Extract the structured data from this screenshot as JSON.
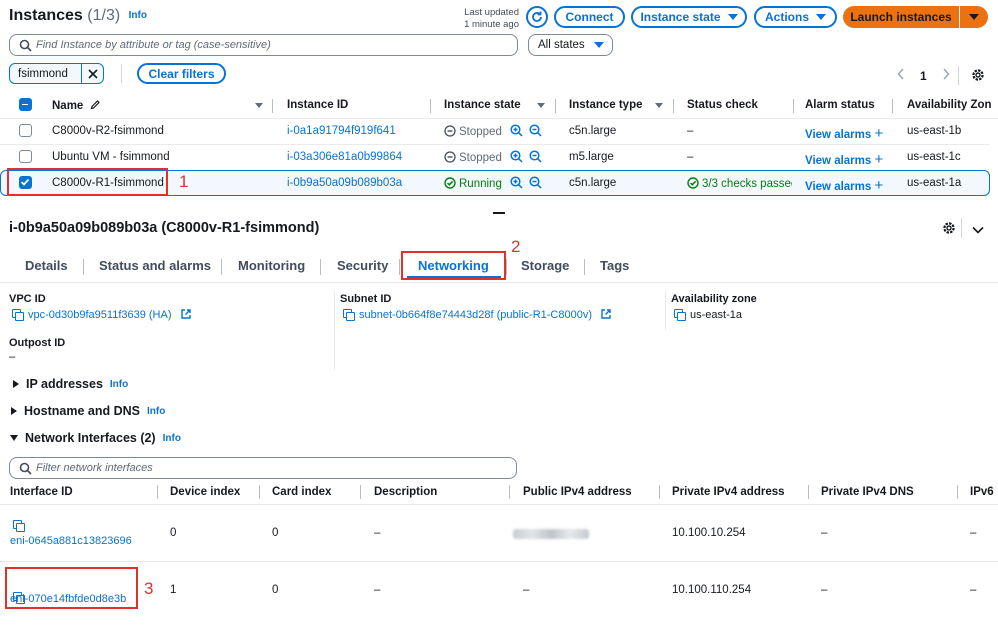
{
  "header": {
    "title": "Instances",
    "count": "(1/3)",
    "info": "Info",
    "last_updated_label": "Last updated",
    "last_updated_value": "1 minute ago",
    "connect": "Connect",
    "instance_state": "Instance state",
    "actions": "Actions",
    "launch": "Launch instances"
  },
  "search": {
    "placeholder": "Find Instance by attribute or tag (case-sensitive)",
    "states_select": "All states"
  },
  "filter": {
    "token": "fsimmond",
    "clear": "Clear filters",
    "page": "1"
  },
  "table": {
    "headers": [
      "Name",
      "Instance ID",
      "Instance state",
      "Instance type",
      "Status check",
      "Alarm status",
      "Availability Zon"
    ],
    "rows": [
      {
        "name": "C8000v-R2-fsimmond",
        "id": "i-0a1a91794f919f641",
        "state": "Stopped",
        "type": "c5n.large",
        "status": "–",
        "alarms": "View alarms",
        "az": "us-east-1b"
      },
      {
        "name": "Ubuntu VM - fsimmond",
        "id": "i-03a306e81a0b99864",
        "state": "Stopped",
        "type": "m5.large",
        "status": "–",
        "alarms": "View alarms",
        "az": "us-east-1c"
      },
      {
        "name": "C8000v-R1-fsimmond",
        "id": "i-0b9a50a09b089b03a",
        "state": "Running",
        "type": "c5n.large",
        "status": "3/3 checks passec",
        "alarms": "View alarms",
        "az": "us-east-1a"
      }
    ]
  },
  "detail": {
    "title": "i-0b9a50a09b089b03a (C8000v-R1-fsimmond)",
    "tabs": [
      "Details",
      "Status and alarms",
      "Monitoring",
      "Security",
      "Networking",
      "Storage",
      "Tags"
    ],
    "active_tab": "Networking",
    "vpc_label": "VPC ID",
    "vpc_value": "vpc-0d30b9fa9511f3639 (HA)",
    "subnet_label": "Subnet ID",
    "subnet_value": "subnet-0b664f8e74443d28f (public-R1-C8000v)",
    "az_label": "Availability zone",
    "az_value": "us-east-1a",
    "outpost_label": "Outpost ID",
    "outpost_value": "–",
    "sections": {
      "ip": "IP addresses",
      "hostname": "Hostname and DNS",
      "ni": "Network Interfaces (2)",
      "info": "Info"
    }
  },
  "ni": {
    "filter_placeholder": "Filter network interfaces",
    "headers": [
      "Interface ID",
      "Device index",
      "Card index",
      "Description",
      "Public IPv4 address",
      "Private IPv4 address",
      "Private IPv4 DNS",
      "IPv6"
    ],
    "rows": [
      {
        "id": "eni-0645a881c13823696",
        "device": "0",
        "card": "0",
        "desc": "–",
        "public": "",
        "private": "10.100.10.254",
        "dns": "–",
        "ipv6": "–"
      },
      {
        "id": "eni-070e14fbfde0d8e3b",
        "device": "1",
        "card": "0",
        "desc": "–",
        "public": "–",
        "private": "10.100.110.254",
        "dns": "–",
        "ipv6": "–"
      }
    ]
  },
  "annotations": [
    "1",
    "2",
    "3"
  ],
  "colors": {
    "accent": "#0972d3",
    "launch": "#ec7211",
    "running": "#037f0c",
    "annotation": "#e0322d"
  }
}
